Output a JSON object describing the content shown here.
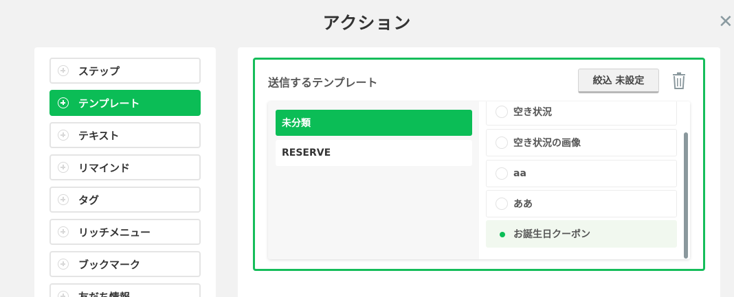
{
  "dialog": {
    "title": "アクション",
    "close_icon": "close-icon"
  },
  "sidebar": {
    "items": [
      {
        "label": "ステップ",
        "active": false
      },
      {
        "label": "テンプレート",
        "active": true
      },
      {
        "label": "テキスト",
        "active": false
      },
      {
        "label": "リマインド",
        "active": false
      },
      {
        "label": "タグ",
        "active": false
      },
      {
        "label": "リッチメニュー",
        "active": false
      },
      {
        "label": "ブックマーク",
        "active": false
      },
      {
        "label": "友だち情報",
        "active": false
      }
    ]
  },
  "template_section": {
    "title": "送信するテンプレート",
    "filter_button": "絞込 未設定",
    "delete_icon": "trash-icon",
    "categories": [
      {
        "label": "未分類",
        "active": true
      },
      {
        "label": "RESERVE",
        "active": false
      }
    ],
    "templates": [
      {
        "label": "空き状況",
        "selected": false
      },
      {
        "label": "空き状況の画像",
        "selected": false
      },
      {
        "label": "aa",
        "selected": false
      },
      {
        "label": "ああ",
        "selected": false
      },
      {
        "label": "お誕生日クーポン",
        "selected": true
      }
    ]
  },
  "colors": {
    "accent": "#0bbd56",
    "border_accent": "#15bd5a",
    "scrollbar": "#8a989d"
  }
}
